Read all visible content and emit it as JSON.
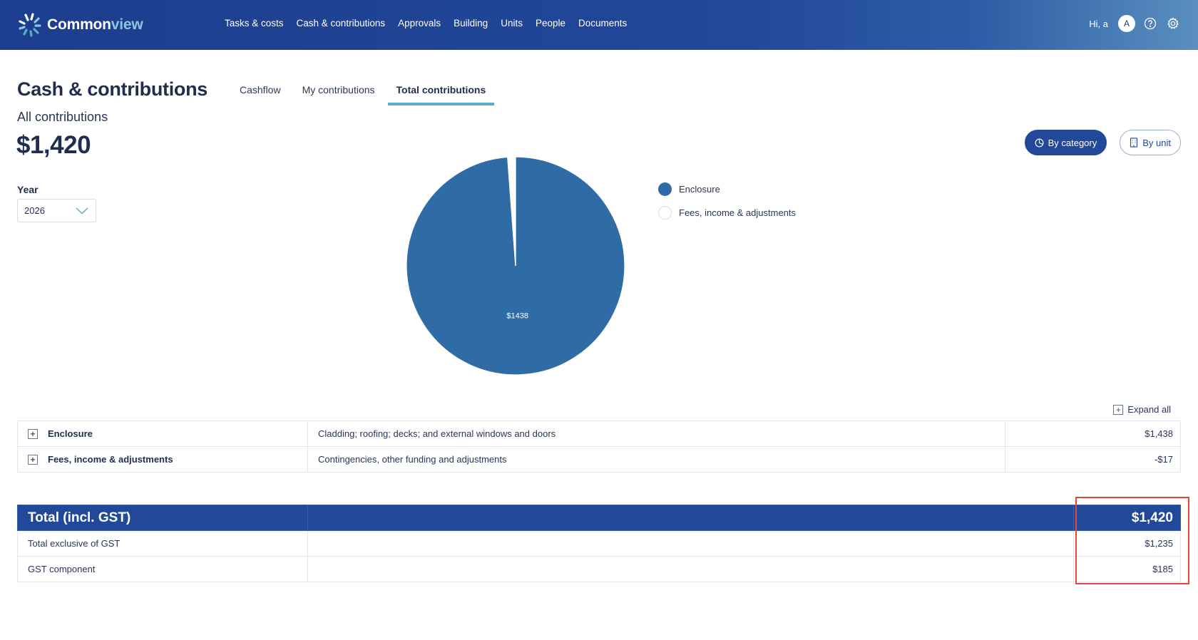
{
  "app": {
    "brand_part1": "Common",
    "brand_part2": "view"
  },
  "nav": {
    "items": [
      "Tasks & costs",
      "Cash & contributions",
      "Approvals",
      "Building",
      "Units",
      "People",
      "Documents"
    ]
  },
  "user": {
    "greeting": "Hi, a",
    "avatar_initial": "A"
  },
  "page": {
    "title": "Cash & contributions",
    "tabs": [
      "Cashflow",
      "My contributions",
      "Total contributions"
    ],
    "active_tab": "Total contributions",
    "subtitle": "All contributions",
    "total": "$1,420"
  },
  "year": {
    "label": "Year",
    "value": "2026"
  },
  "view_toggle": {
    "by_category": "By category",
    "by_unit": "By unit",
    "active": "By category"
  },
  "chart_data": {
    "type": "pie",
    "categories": [
      "Enclosure",
      "Fees, income & adjustments"
    ],
    "values": [
      1438,
      -17
    ],
    "slice_labels": [
      "$1438",
      ""
    ],
    "colors": [
      "#2f6ca6",
      "#ffffff"
    ],
    "legend_position": "right"
  },
  "table": {
    "expand_all_label": "Expand all",
    "rows": [
      {
        "name": "Enclosure",
        "description": "Cladding; roofing; decks; and external windows and doors",
        "amount": "$1,438"
      },
      {
        "name": "Fees, income & adjustments",
        "description": "Contingencies, other funding and adjustments",
        "amount": "-$17"
      }
    ]
  },
  "totals": {
    "header_label": "Total (incl. GST)",
    "header_amount": "$1,420",
    "rows": [
      {
        "label": "Total exclusive of GST",
        "amount": "$1,235"
      },
      {
        "label": "GST component",
        "amount": "$185"
      }
    ]
  },
  "colors": {
    "nav_bg": "#22489a",
    "accent": "#5fa9c9",
    "pie_main": "#2f6ca6",
    "highlight": "#e0493c"
  },
  "icons": {
    "logo": "commonview-logo-icon",
    "help": "help-icon",
    "settings": "gear-icon",
    "year_dropdown": "chevron-down-icon",
    "by_category": "pie-chart-icon",
    "by_unit": "building-icon",
    "expand": "plus-box-icon"
  }
}
